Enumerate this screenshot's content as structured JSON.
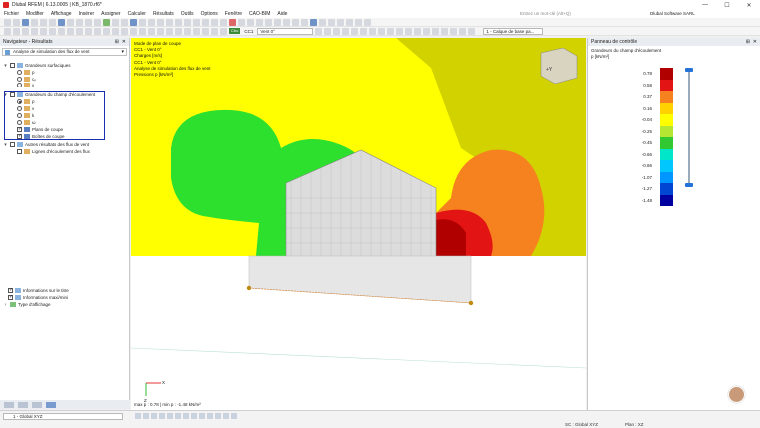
{
  "window": {
    "title": "Dlubal RFEM | 6.13.0005 | KB_1870.rf6*",
    "minimize": "—",
    "maximize": "☐",
    "close": "✕"
  },
  "menu": [
    "Fichier",
    "Modifier",
    "Affichage",
    "Insérer",
    "Assigner",
    "Calculer",
    "Résultats",
    "Outils",
    "Options",
    "Fenêtre",
    "CAO-BIM",
    "Aide"
  ],
  "search": {
    "placeholder": "Entrez un mot-clé (Alt+Q)"
  },
  "company": "Dlubal Software SARL",
  "toolbar2": {
    "cc_badge": "Cbo",
    "cc_label": "CC1",
    "load_case": "Vent 0°",
    "layer": "1 - Calque de base pa..."
  },
  "navigator": {
    "title": "Navigateur - Résultats",
    "pin": "⊞",
    "close": "✕",
    "combo": "Analyse de simulation des flux de vent",
    "items": [
      {
        "label": "Grandeurs surfaciques"
      },
      {
        "label": "p"
      },
      {
        "label": "cₚ"
      },
      {
        "label": "ν"
      },
      {
        "label": "Grandeurs du champ d'écoulement"
      },
      {
        "label": "p"
      },
      {
        "label": "v"
      },
      {
        "label": "k"
      },
      {
        "label": "ω"
      },
      {
        "label": "Plans de coupe"
      },
      {
        "label": "Boîtes de coupe"
      },
      {
        "label": "Autres résultats des flux de vent"
      },
      {
        "label": "Lignes d'écoulement des flux"
      },
      {
        "label": "Informations sur le titre"
      },
      {
        "label": "Informations maxi/mini"
      },
      {
        "label": "Type d'affichage"
      }
    ]
  },
  "viewport": {
    "info_lines": [
      "Mode de plan de coupe",
      "CC1 - Vent 0°",
      "Charges [m/s]",
      "CC1 - Vent 0°",
      "Analyse de simulation des flux de vent",
      "Pressions p [kN/m²]"
    ],
    "minmax": "max p : 0.78 | min p : -1.48 kN/m²",
    "cube_label": "+Y",
    "axis_x": "X",
    "axis_z": "Z"
  },
  "control_panel": {
    "title": "Panneau de contrôle",
    "subtitle1": "Grandeurs du champ d'écoulement",
    "subtitle2": "p [kN/m²]",
    "legend": [
      {
        "value": "0.78",
        "color": "#b00000"
      },
      {
        "value": "0.58",
        "color": "#e31414"
      },
      {
        "value": "0.37",
        "color": "#f5821f"
      },
      {
        "value": "0.16",
        "color": "#ffd200"
      },
      {
        "value": "-0.04",
        "color": "#ffff00"
      },
      {
        "value": "-0.25",
        "color": "#b4e632"
      },
      {
        "value": "-0.45",
        "color": "#32c832"
      },
      {
        "value": "-0.66",
        "color": "#00e6c8"
      },
      {
        "value": "-0.86",
        "color": "#00c8ff"
      },
      {
        "value": "-1.07",
        "color": "#0096ff"
      },
      {
        "value": "-1.27",
        "color": "#0046d2"
      },
      {
        "value": "-1.48",
        "color": "#0000a0"
      }
    ]
  },
  "statusbar": {
    "view_combo": "1 - Global XYZ",
    "cs": "SC : Global XYZ",
    "plane": "Plan : XZ"
  }
}
